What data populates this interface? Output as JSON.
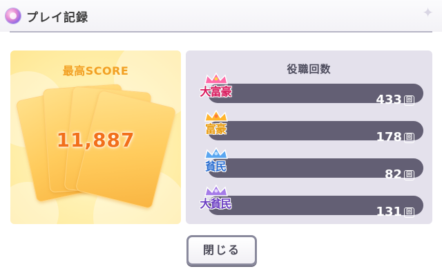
{
  "header": {
    "title": "プレイ記録",
    "icon": "play-record-icon",
    "decor_icon": "sparkle-icon"
  },
  "score": {
    "label": "最高SCORE",
    "value": "11,887"
  },
  "roles": {
    "title": "役職回数",
    "unit": "回",
    "items": [
      {
        "name": "大富豪",
        "count": "433",
        "color": "#d8175b"
      },
      {
        "name": "富豪",
        "count": "178",
        "color": "#e79a0f"
      },
      {
        "name": "貧民",
        "count": "82",
        "color": "#2d6fd1"
      },
      {
        "name": "大貧民",
        "count": "131",
        "color": "#6c3fc2"
      }
    ]
  },
  "actions": {
    "close_label": "閉じる"
  },
  "colors": {
    "accent_orange": "#f26f1a",
    "panel_lavender": "#e4e1ec",
    "bar_dark": "#635f74"
  }
}
